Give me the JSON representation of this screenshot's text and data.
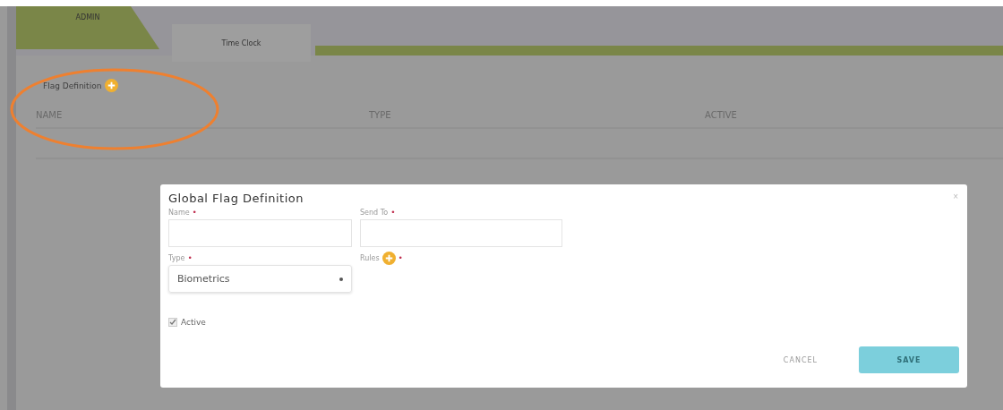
{
  "tabs": [
    {
      "label": "ADMIN",
      "selected": true
    },
    {
      "label": "Time Clock",
      "selected": false
    }
  ],
  "section": {
    "title": "Flag Definition"
  },
  "table": {
    "columns": [
      "NAME",
      "TYPE",
      "ACTIVE"
    ]
  },
  "dialog": {
    "title": "Global Flag Definition",
    "close": "×",
    "required_mark": "•",
    "fields": [
      {
        "kind": "text",
        "label": "Name",
        "required": true
      },
      {
        "kind": "text",
        "label": "Send To",
        "required": true
      },
      {
        "kind": "select",
        "label": "Type",
        "required": true,
        "value": "Biometrics"
      },
      {
        "kind": "add",
        "label": "Rules",
        "required": true
      }
    ],
    "active": {
      "label": "Active",
      "checked": true
    },
    "buttons": [
      {
        "label": "CANCEL",
        "kind": "flat"
      },
      {
        "label": "SAVE",
        "kind": "primary"
      }
    ]
  }
}
